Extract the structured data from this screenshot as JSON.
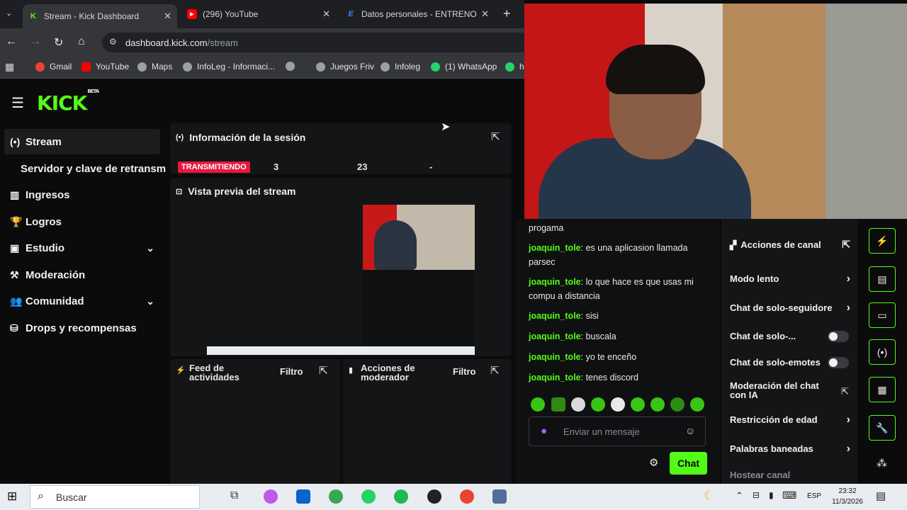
{
  "browser": {
    "tabs": [
      {
        "title": "Stream - Kick Dashboard",
        "favicon": "kick-logo",
        "active": true
      },
      {
        "title": "(296) YouTube",
        "favicon": "youtube-logo",
        "active": false
      },
      {
        "title": "Datos personales - ENTRENO",
        "favicon": "e-logo",
        "active": false
      }
    ],
    "url_domain": "dashboard.kick.com",
    "url_path": "/stream",
    "bookmarks": [
      "Gmail",
      "YouTube",
      "Maps",
      "InfoLeg - Informaci...",
      "",
      "Juegos Friv",
      "Infoleg",
      "(1) WhatsApp",
      "h"
    ]
  },
  "app": {
    "logo_text": "KICK",
    "logo_badge": "BETA",
    "nav": [
      {
        "label": "Stream",
        "icon": "broadcast-icon",
        "active": true
      },
      {
        "label": "Servidor y clave de retransm",
        "icon": "",
        "active": false
      },
      {
        "label": "Ingresos",
        "icon": "chart-icon",
        "active": false
      },
      {
        "label": "Logros",
        "icon": "trophy-icon",
        "active": false
      },
      {
        "label": "Estudio",
        "icon": "studio-icon",
        "active": false,
        "expandable": true
      },
      {
        "label": "Moderación",
        "icon": "hammer-icon",
        "active": false
      },
      {
        "label": "Comunidad",
        "icon": "people-icon",
        "active": false,
        "expandable": true
      },
      {
        "label": "Drops y recompensas",
        "icon": "drops-icon",
        "active": false
      }
    ],
    "session": {
      "title": "Información de la sesión",
      "status": "TRANSMITIENDO",
      "stat1": "3",
      "stat2": "23",
      "stat3": "-"
    },
    "preview": {
      "title": "Vista previa del stream"
    },
    "feed": {
      "title_line1": "Feed de",
      "title_line2": "actividades",
      "filter": "Filtro"
    },
    "modactions": {
      "title_line1": "Acciones de",
      "title_line2": "moderador",
      "filter": "Filtro"
    }
  },
  "chat": {
    "messages": [
      {
        "user": "",
        "text": "progama"
      },
      {
        "user": "joaquin_tole",
        "text": "es una aplicasion llamada parsec"
      },
      {
        "user": "joaquin_tole",
        "text": "lo que hace es que usas mi compu a distancia"
      },
      {
        "user": "joaquin_tole",
        "text": "sisi"
      },
      {
        "user": "joaquin_tole",
        "text": "buscala"
      },
      {
        "user": "joaquin_tole",
        "text": "yo te enceño"
      },
      {
        "user": "joaquin_tole",
        "text": "tenes discord"
      }
    ],
    "input_placeholder": "Enviar un mensaje",
    "send_label": "Chat"
  },
  "actions": {
    "title": "Acciones de canal",
    "items": [
      {
        "label": "Modo lento",
        "kind": "arrow"
      },
      {
        "label": "Chat de solo-seguidore",
        "kind": "arrow"
      },
      {
        "label": "Chat de solo-...",
        "kind": "toggle"
      },
      {
        "label": "Chat de solo-emotes",
        "kind": "toggle"
      },
      {
        "label": "Moderación del chat con IA",
        "kind": "external"
      },
      {
        "label": "Restricción de edad",
        "kind": "arrow"
      },
      {
        "label": "Palabras baneadas",
        "kind": "arrow"
      },
      {
        "label": "Hostear canal",
        "kind": "none"
      }
    ]
  },
  "taskbar": {
    "search_placeholder": "Buscar",
    "lang": "ESP",
    "time": "23:32",
    "date": "11/3/2026"
  },
  "colors": {
    "accent": "#53fc18",
    "live": "#e8173f"
  }
}
